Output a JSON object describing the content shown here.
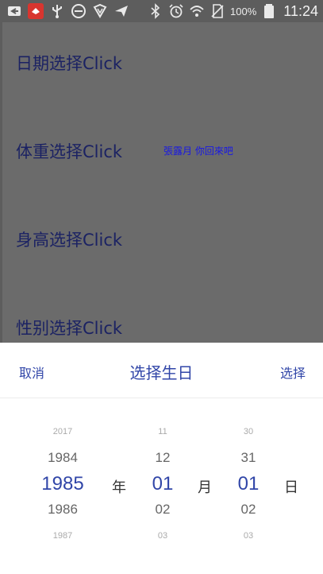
{
  "status_bar": {
    "battery_percent": "100%",
    "time": "11:24",
    "icons": [
      "back-arrow-icon",
      "app-badge-icon",
      "usb-icon",
      "do-not-disturb-icon",
      "vpn-shield-icon",
      "send-icon",
      "bluetooth-icon",
      "alarm-icon",
      "wifi-icon",
      "no-sim-icon",
      "battery-icon"
    ]
  },
  "page": {
    "items": [
      "日期选择Click",
      "体重选择Click",
      "身高选择Click",
      "性别选择Click"
    ],
    "name_tag": "張露月 你回來吧"
  },
  "picker": {
    "cancel_label": "取消",
    "title": "选择生日",
    "confirm_label": "选择",
    "year": {
      "prev2": "2017",
      "prev1": "1984",
      "selected": "1985",
      "next1": "1986",
      "next2": "1987",
      "unit": "年"
    },
    "month": {
      "prev2": "11",
      "prev1": "12",
      "selected": "01",
      "next1": "02",
      "next2": "03",
      "unit": "月"
    },
    "day": {
      "prev2": "30",
      "prev1": "31",
      "selected": "01",
      "next1": "02",
      "next2": "03",
      "unit": "日"
    },
    "accent_color": "#3146a8"
  }
}
